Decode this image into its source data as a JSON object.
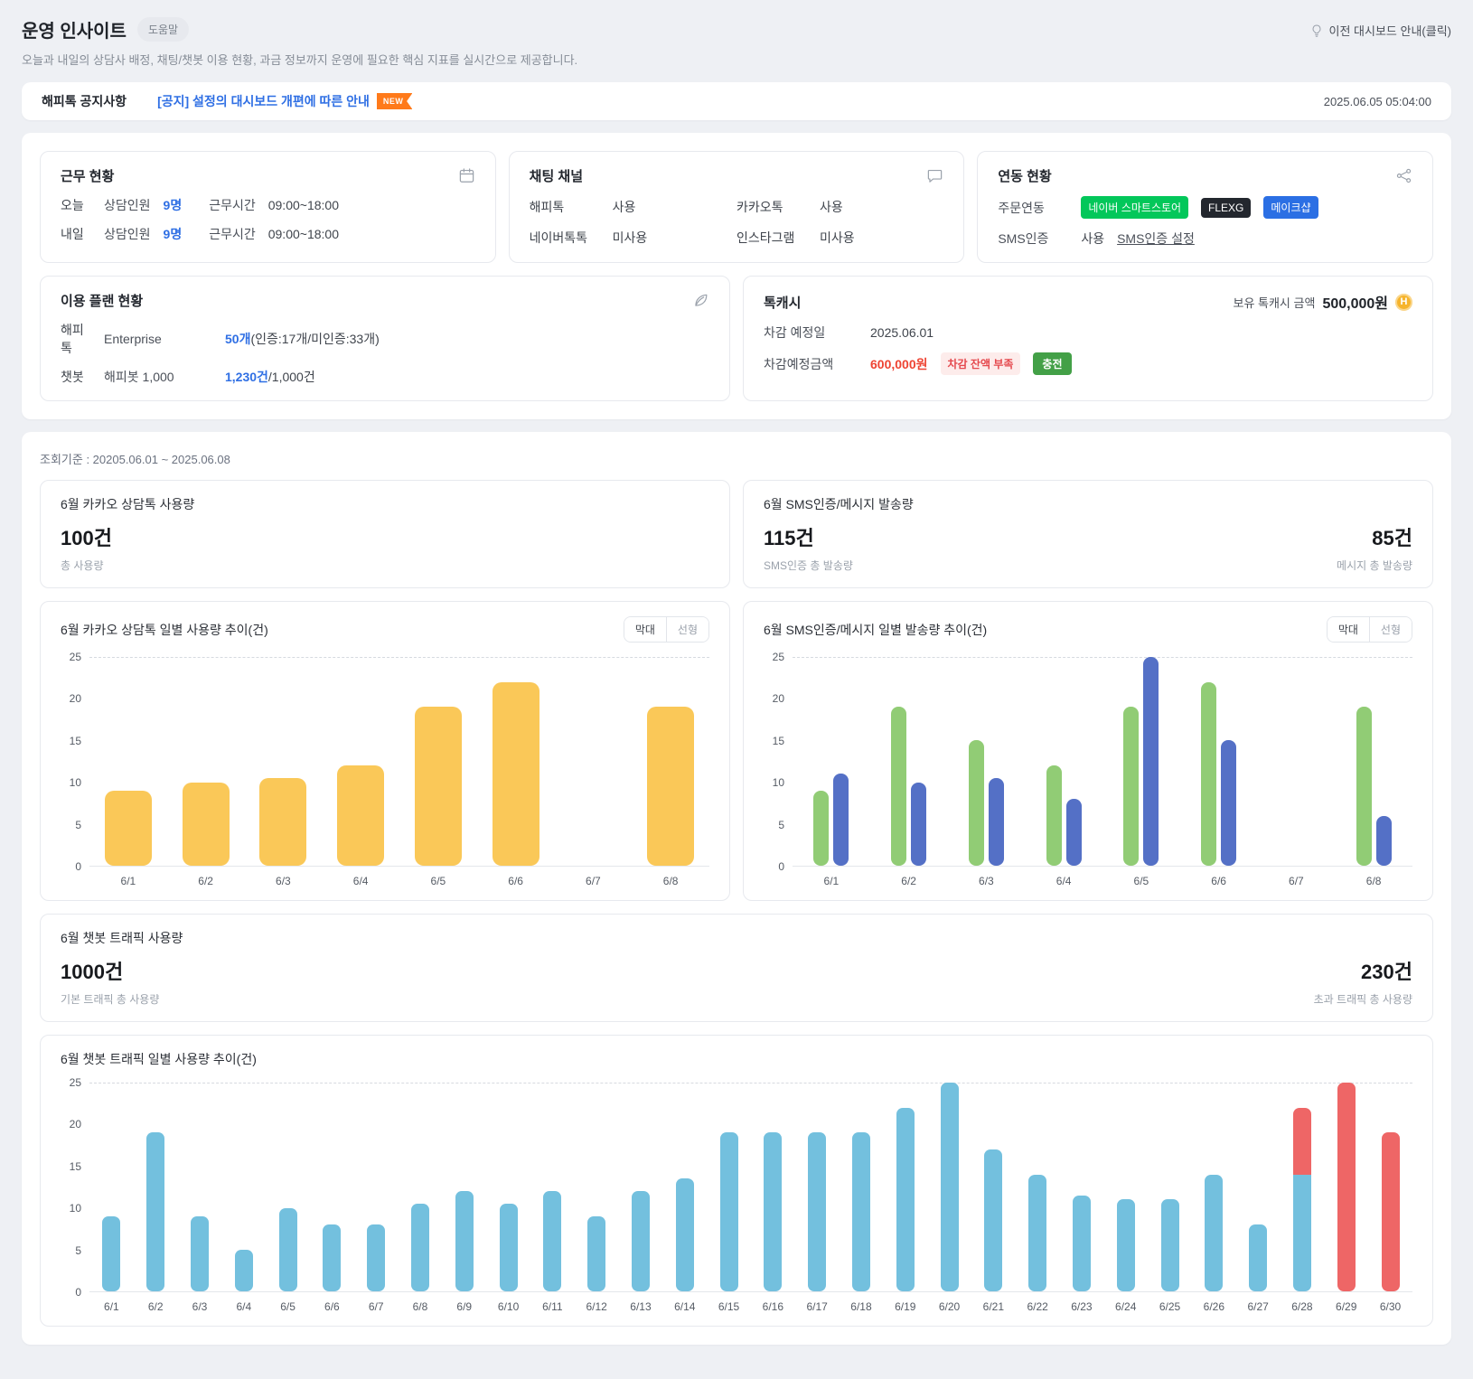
{
  "page": {
    "title": "운영 인사이트",
    "help_badge": "도움말",
    "subtitle": "오늘과 내일의 상담사 배정, 채팅/챗봇 이용 현황, 과금 정보까지 운영에 필요한 핵심 지표를 실시간으로 제공합니다.",
    "prev_dashboard_link": "이전 대시보드 안내(클릭)"
  },
  "notice": {
    "label": "해피톡 공지사항",
    "link": "[공지] 설정의 대시보드 개편에 따른 안내",
    "new_badge": "NEW",
    "timestamp": "2025.06.05 05:04:00"
  },
  "work_status": {
    "title": "근무 현황",
    "rows": [
      {
        "day": "오늘",
        "label": "상담인원",
        "count": "9명",
        "time_label": "근무시간",
        "time": "09:00~18:00"
      },
      {
        "day": "내일",
        "label": "상담인원",
        "count": "9명",
        "time_label": "근무시간",
        "time": "09:00~18:00"
      }
    ]
  },
  "chat_channels": {
    "title": "채팅 채널",
    "items": [
      {
        "name": "해피톡",
        "status": "사용"
      },
      {
        "name": "카카오톡",
        "status": "사용"
      },
      {
        "name": "네이버톡톡",
        "status": "미사용"
      },
      {
        "name": "인스타그램",
        "status": "미사용"
      }
    ]
  },
  "integration": {
    "title": "연동 현황",
    "order_label": "주문연동",
    "badges": [
      {
        "label": "네이버 스마트스토어",
        "color": "#03c75a"
      },
      {
        "label": "FLEXG",
        "color": "#23272e"
      },
      {
        "label": "메이크샵",
        "color": "#2b6fe4"
      }
    ],
    "sms_label": "SMS인증",
    "sms_status": "사용",
    "sms_settings_link": "SMS인증 설정"
  },
  "plan": {
    "title": "이용 플랜 현황",
    "rows": [
      {
        "name": "해피톡",
        "plan": "Enterprise",
        "value": "50개",
        "detail": "(인증:17개/미인증:33개)"
      },
      {
        "name": "챗봇",
        "plan": "해피봇 1,000",
        "value": "1,230건",
        "detail": "/1,000건"
      }
    ]
  },
  "talkcash": {
    "title": "톡캐시",
    "balance_label": "보유 톡캐시 금액",
    "balance": "500,000원",
    "coin_label": "H",
    "deduct_date_label": "차감 예정일",
    "deduct_date": "2025.06.01",
    "deduct_amount_label": "차감예정금액",
    "deduct_amount": "600,000원",
    "warning_badge": "차감 잔액 부족",
    "charge_button": "충전"
  },
  "period": "조회기준 : 20205.06.01 ~ 2025.06.08",
  "labels": {
    "toggle_bar": "막대",
    "toggle_line": "선형"
  },
  "summaries": {
    "kakao": {
      "title": "6월 카카오 상담톡 사용량",
      "value": "100건",
      "caption": "총 사용량"
    },
    "sms": {
      "title": "6월 SMS인증/메시지 발송량",
      "left_value": "115건",
      "left_caption": "SMS인증 총 발송량",
      "right_value": "85건",
      "right_caption": "메시지 총 발송량"
    },
    "bot": {
      "title": "6월 챗봇 트래픽 사용량",
      "left_value": "1000건",
      "left_caption": "기본 트래픽 총 사용량",
      "right_value": "230건",
      "right_caption": "초과 트래픽 총 사용량"
    }
  },
  "colors": {
    "accent_blue": "#2f6fe4",
    "alert_red": "#ee4433",
    "bar_yellow": "#fac858",
    "bar_green": "#91cc75",
    "bar_blue": "#5470c6",
    "bar_sky": "#73c0de",
    "bar_red": "#ee6666",
    "charge_green": "#43a047",
    "new_orange": "#ff7a1a"
  },
  "chart_data": [
    {
      "type": "bar",
      "title": "6월 카카오 상담톡 일별 사용량 추이(건)",
      "categories": [
        "6/1",
        "6/2",
        "6/3",
        "6/4",
        "6/5",
        "6/6",
        "6/7",
        "6/8"
      ],
      "series": [
        {
          "name": "사용량",
          "color": "#fac858",
          "values": [
            9,
            10,
            10.5,
            12,
            19,
            22,
            0,
            19
          ]
        }
      ],
      "xlabel": "",
      "ylabel": "",
      "ylim": [
        0,
        25
      ],
      "yticks": [
        0,
        5,
        10,
        15,
        20,
        25
      ],
      "grid": "dashed-top-only",
      "legend": "none"
    },
    {
      "type": "bar",
      "title": "6월 SMS인증/메시지 일별 발송량 추이(건)",
      "categories": [
        "6/1",
        "6/2",
        "6/3",
        "6/4",
        "6/5",
        "6/6",
        "6/7",
        "6/8"
      ],
      "series": [
        {
          "name": "SMS인증",
          "color": "#91cc75",
          "values": [
            9,
            19,
            15,
            12,
            19,
            22,
            0,
            19
          ]
        },
        {
          "name": "메시지",
          "color": "#5470c6",
          "values": [
            11,
            10,
            10.5,
            8,
            25,
            15,
            0,
            6
          ]
        }
      ],
      "xlabel": "",
      "ylabel": "",
      "ylim": [
        0,
        25
      ],
      "yticks": [
        0,
        5,
        10,
        15,
        20,
        25
      ],
      "grid": "dashed-top-only",
      "legend": "none"
    },
    {
      "type": "stacked-bar",
      "title": "6월 챗봇 트래픽 일별 사용량 추이(건)",
      "categories": [
        "6/1",
        "6/2",
        "6/3",
        "6/4",
        "6/5",
        "6/6",
        "6/7",
        "6/8",
        "6/9",
        "6/10",
        "6/11",
        "6/12",
        "6/13",
        "6/14",
        "6/15",
        "6/16",
        "6/17",
        "6/18",
        "6/19",
        "6/20",
        "6/21",
        "6/22",
        "6/23",
        "6/24",
        "6/25",
        "6/26",
        "6/27",
        "6/28",
        "6/29",
        "6/30"
      ],
      "series": [
        {
          "name": "기본 트래픽",
          "color": "#73c0de",
          "values": [
            9,
            19,
            9,
            5,
            10,
            8,
            8,
            10.5,
            12,
            10.5,
            12,
            9,
            12,
            13.5,
            19,
            19,
            19,
            19,
            22,
            25,
            17,
            14,
            11.5,
            11,
            11,
            14,
            8,
            14,
            0,
            0
          ]
        },
        {
          "name": "초과 트래픽",
          "color": "#ee6666",
          "values": [
            0,
            0,
            0,
            0,
            0,
            0,
            0,
            0,
            0,
            0,
            0,
            0,
            0,
            0,
            0,
            0,
            0,
            0,
            0,
            0,
            0,
            0,
            0,
            0,
            0,
            0,
            0,
            8,
            25,
            19
          ]
        }
      ],
      "xlabel": "",
      "ylabel": "",
      "ylim": [
        0,
        25
      ],
      "yticks": [
        0,
        5,
        10,
        15,
        20,
        25
      ],
      "grid": "dashed-top-only",
      "legend": "none"
    }
  ]
}
